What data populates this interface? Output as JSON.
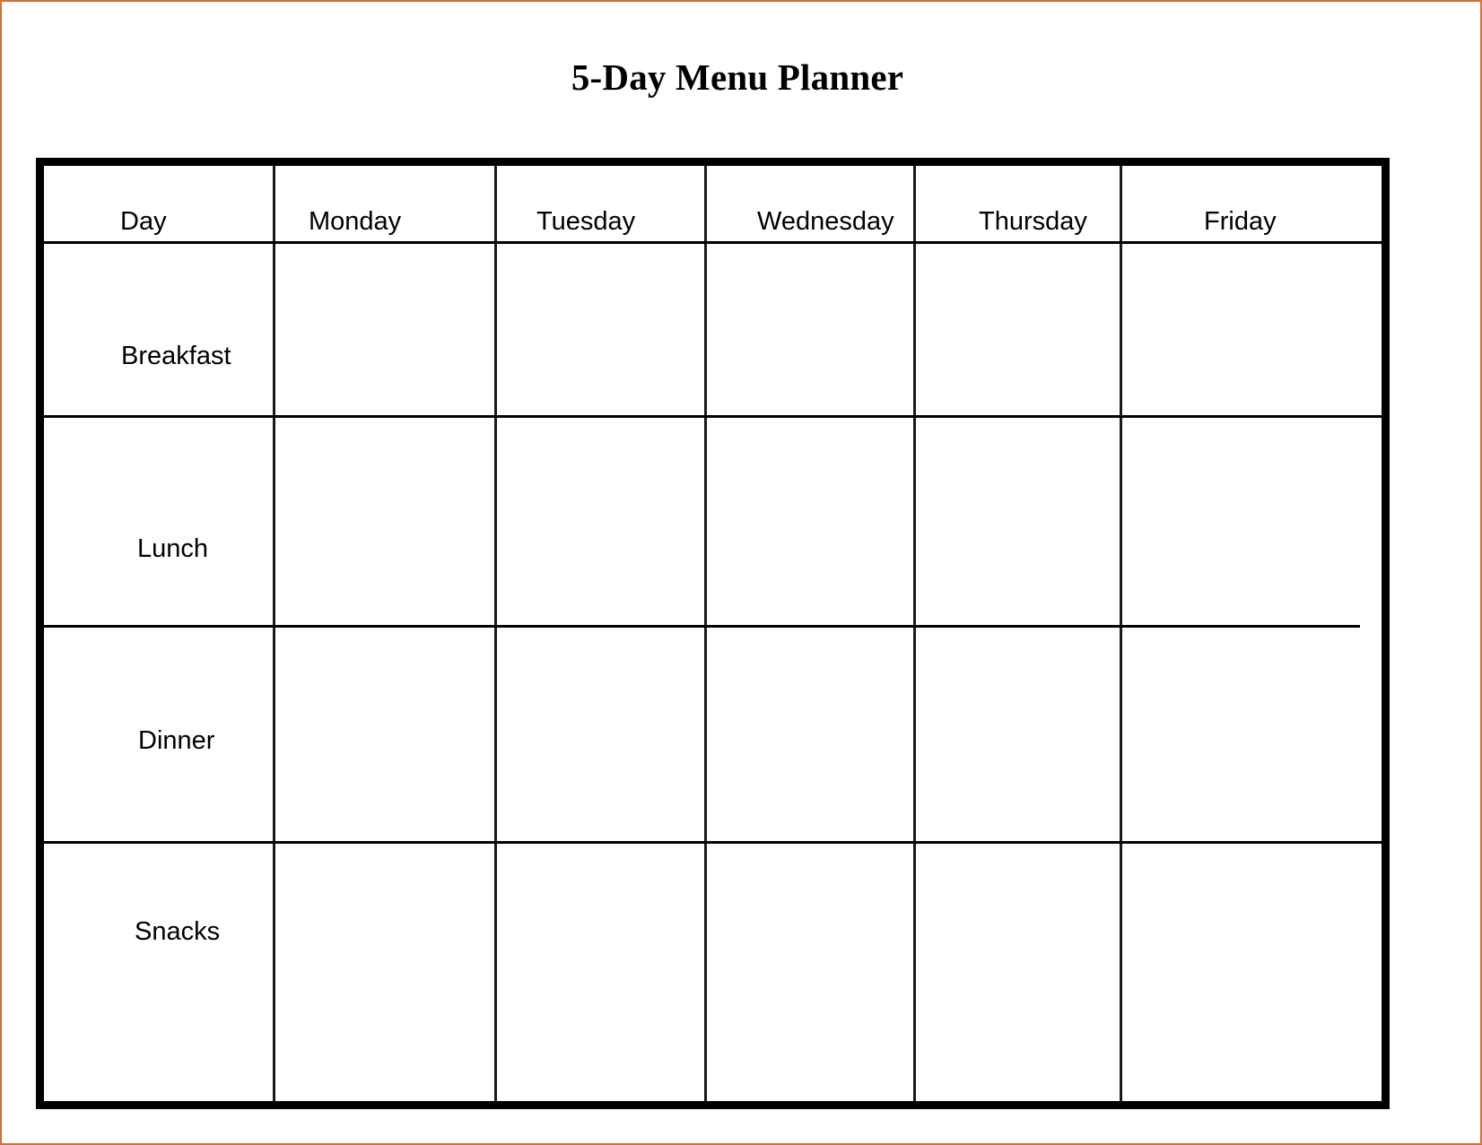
{
  "document": {
    "title": "5-Day Menu Planner"
  },
  "colors": {
    "page_border": "#d2703a",
    "table_frame": "#000000",
    "grid_line": "#1a1a1a",
    "text": "#000000",
    "background": "#ffffff"
  },
  "table": {
    "column_headers": [
      "Day",
      "Monday",
      "Tuesday",
      "Wednesday",
      "Thursday",
      "Friday"
    ],
    "row_labels": [
      "Breakfast",
      "Lunch",
      "Dinner",
      "Snacks"
    ],
    "rows": [
      {
        "label": "Breakfast",
        "cells": [
          "",
          "",
          "",
          "",
          ""
        ]
      },
      {
        "label": "Lunch",
        "cells": [
          "",
          "",
          "",
          "",
          ""
        ]
      },
      {
        "label": "Dinner",
        "cells": [
          "",
          "",
          "",
          "",
          ""
        ]
      },
      {
        "label": "Snacks",
        "cells": [
          "",
          "",
          "",
          "",
          ""
        ]
      }
    ],
    "cell_placeholder": ""
  }
}
